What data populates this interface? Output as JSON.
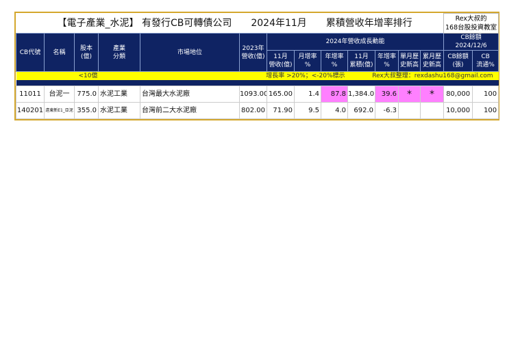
{
  "title": {
    "part1": "【電子產業_水泥】 有發行CB可轉債公司",
    "part2": "2024年11月",
    "part3": "累積營收年增率排行"
  },
  "brand": {
    "line1": "Rex大叔的",
    "line2": "168台股投資教室"
  },
  "headers": {
    "cb_code": "CB代號",
    "name": "名稱",
    "capital": "股本\n(億)",
    "industry": "產業\n分類",
    "market": "市場地位",
    "rev2023": "2023年\n營收(億)",
    "group": "2024年營收成長動能",
    "cb_group": "CB餘額\n2024/12/6",
    "sub": [
      "11月\n營收(億)",
      "月增率\n%",
      "年增率\n%",
      "11月\n累積(億)",
      "年增率\n%",
      "單月歷\n史新高",
      "累月歷\n史新高",
      "CB餘額\n(張)",
      "CB\n流通%"
    ]
  },
  "notes": {
    "capital": "<10億",
    "growth": "增長率 >20%；<-20%標示",
    "author": "Rex大叔整理：rexdashu168@gmail.com"
  },
  "rows": [
    {
      "code": "11011",
      "name": "台泥一",
      "capital": "775.0",
      "industry": "水泥工業",
      "market": "台灣最大水泥廠",
      "rev2023": "1093.00",
      "nov_rev": "165.00",
      "mom": "1.4",
      "yoy": "87.8",
      "cum": "1,384.0",
      "cum_yoy": "39.6",
      "month_high": "*",
      "cum_high": "*",
      "cb_bal": "80,000",
      "cb_pct": "100"
    },
    {
      "code": "140201",
      "name": "遠東新E1_亞泥",
      "capital": "355.0",
      "industry": "水泥工業",
      "market": "台灣前二大水泥廠",
      "rev2023": "802.00",
      "nov_rev": "71.90",
      "mom": "9.5",
      "yoy": "4.0",
      "cum": "692.0",
      "cum_yoy": "-6.3",
      "month_high": "",
      "cum_high": "",
      "cb_bal": "10,000",
      "cb_pct": "100"
    }
  ],
  "colors": {
    "header": "#0f2363",
    "highlight": "#ff80ff",
    "note": "#ffff00",
    "border": "#d4a72c"
  }
}
